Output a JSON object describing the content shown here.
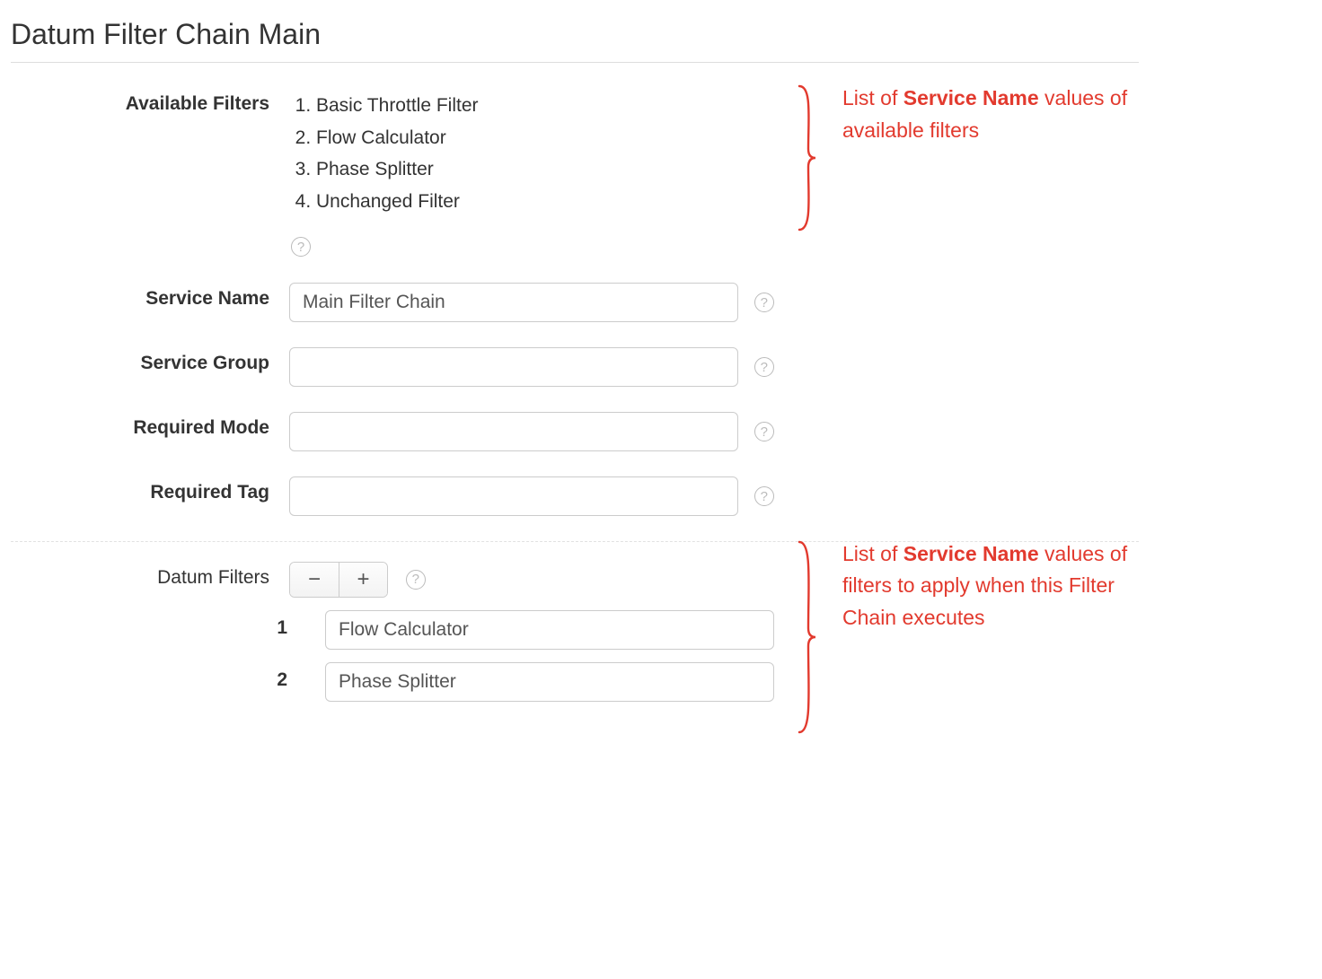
{
  "page_title": "Datum Filter Chain Main",
  "available_filters": {
    "label": "Available Filters",
    "items": [
      "Basic Throttle Filter",
      "Flow Calculator",
      "Phase Splitter",
      "Unchanged Filter"
    ]
  },
  "fields": {
    "service_name": {
      "label": "Service Name",
      "value": "Main Filter Chain"
    },
    "service_group": {
      "label": "Service Group",
      "value": ""
    },
    "required_mode": {
      "label": "Required Mode",
      "value": ""
    },
    "required_tag": {
      "label": "Required Tag",
      "value": ""
    }
  },
  "datum_filters": {
    "label": "Datum Filters",
    "rows": [
      {
        "index": "1",
        "value": "Flow Calculator"
      },
      {
        "index": "2",
        "value": "Phase Splitter"
      }
    ]
  },
  "annotations": {
    "top": {
      "prefix": "List of ",
      "bold": "Service Name",
      "suffix": " values of available filters"
    },
    "bottom": {
      "prefix": "List of ",
      "bold": "Service Name",
      "suffix": " values of filters to apply when this Filter Chain executes"
    }
  },
  "icons": {
    "help": "?",
    "minus": "−",
    "plus": "+"
  }
}
